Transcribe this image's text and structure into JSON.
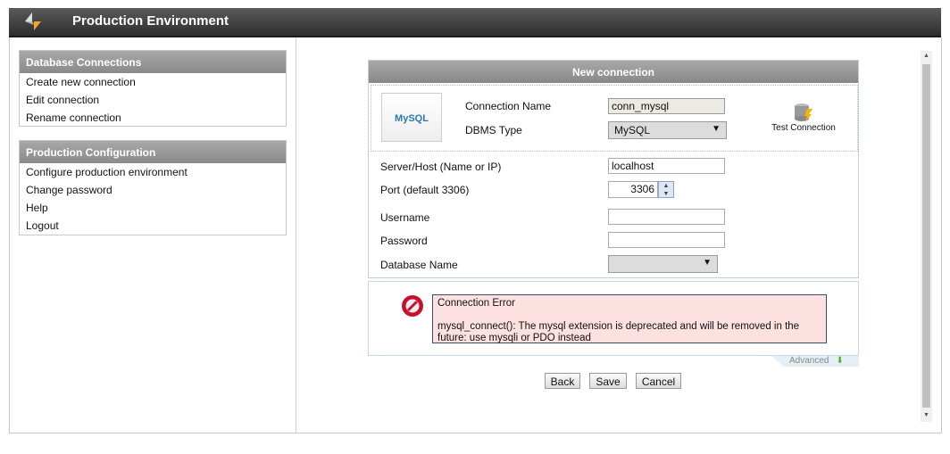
{
  "header": {
    "title": "Production Environment",
    "logo_icon": "arrows-logo-icon"
  },
  "sidebar": {
    "groups": [
      {
        "title": "Database Connections",
        "items": [
          {
            "label": "Create new connection"
          },
          {
            "label": "Edit connection"
          },
          {
            "label": "Rename connection"
          }
        ]
      },
      {
        "title": "Production Configuration",
        "items": [
          {
            "label": "Configure production environment"
          },
          {
            "label": "Change password"
          },
          {
            "label": "Help"
          },
          {
            "label": "Logout"
          }
        ]
      }
    ]
  },
  "form": {
    "title": "New connection",
    "dbms_logo": "MySQL",
    "connection_name": {
      "label": "Connection Name",
      "value": "conn_mysql"
    },
    "dbms_type": {
      "label": "DBMS Type",
      "value": "MySQL"
    },
    "test_connection": "Test Connection",
    "server": {
      "label": "Server/Host (Name or IP)",
      "value": "localhost"
    },
    "port": {
      "label": "Port (default 3306)",
      "value": "3306"
    },
    "username": {
      "label": "Username",
      "value": ""
    },
    "password": {
      "label": "Password",
      "value": ""
    },
    "database": {
      "label": "Database Name",
      "value": ""
    }
  },
  "error": {
    "title": "Connection Error",
    "message": "mysql_connect(): The mysql extension is deprecated and will be removed in the future: use mysqli or PDO instead"
  },
  "advanced": "Advanced",
  "buttons": {
    "back": "Back",
    "save": "Save",
    "cancel": "Cancel"
  },
  "colors": {
    "error_bg": "#fde0e0",
    "header": "#3a3a3a",
    "accent": "#f5a623"
  }
}
